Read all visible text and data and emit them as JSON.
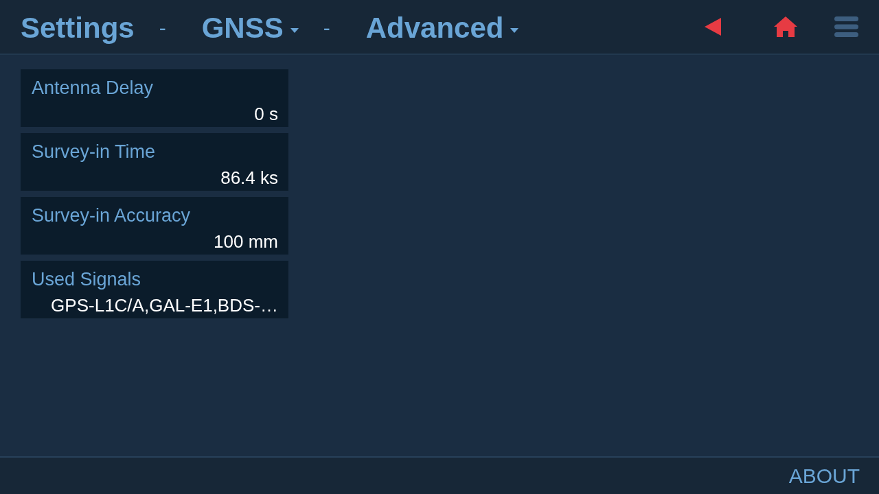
{
  "header": {
    "breadcrumbs": [
      {
        "label": "Settings",
        "has_menu": false
      },
      {
        "separator": "-",
        "label": "GNSS",
        "has_menu": true
      },
      {
        "separator": "-",
        "label": "Advanced",
        "has_menu": true
      }
    ],
    "toolbar": [
      {
        "kind": "back"
      },
      {
        "kind": "home"
      },
      {
        "kind": "menu"
      }
    ]
  },
  "settings": [
    {
      "label": "Antenna Delay",
      "value": "0 s"
    },
    {
      "label": "Survey-in Time",
      "value": "86.4 ks"
    },
    {
      "label": "Survey-in Accuracy",
      "value": "100 mm"
    },
    {
      "label": "Used Signals",
      "value": "GPS-L1C/A,GAL-E1,BDS-…"
    }
  ],
  "footer": {
    "link": "ABOUT"
  }
}
